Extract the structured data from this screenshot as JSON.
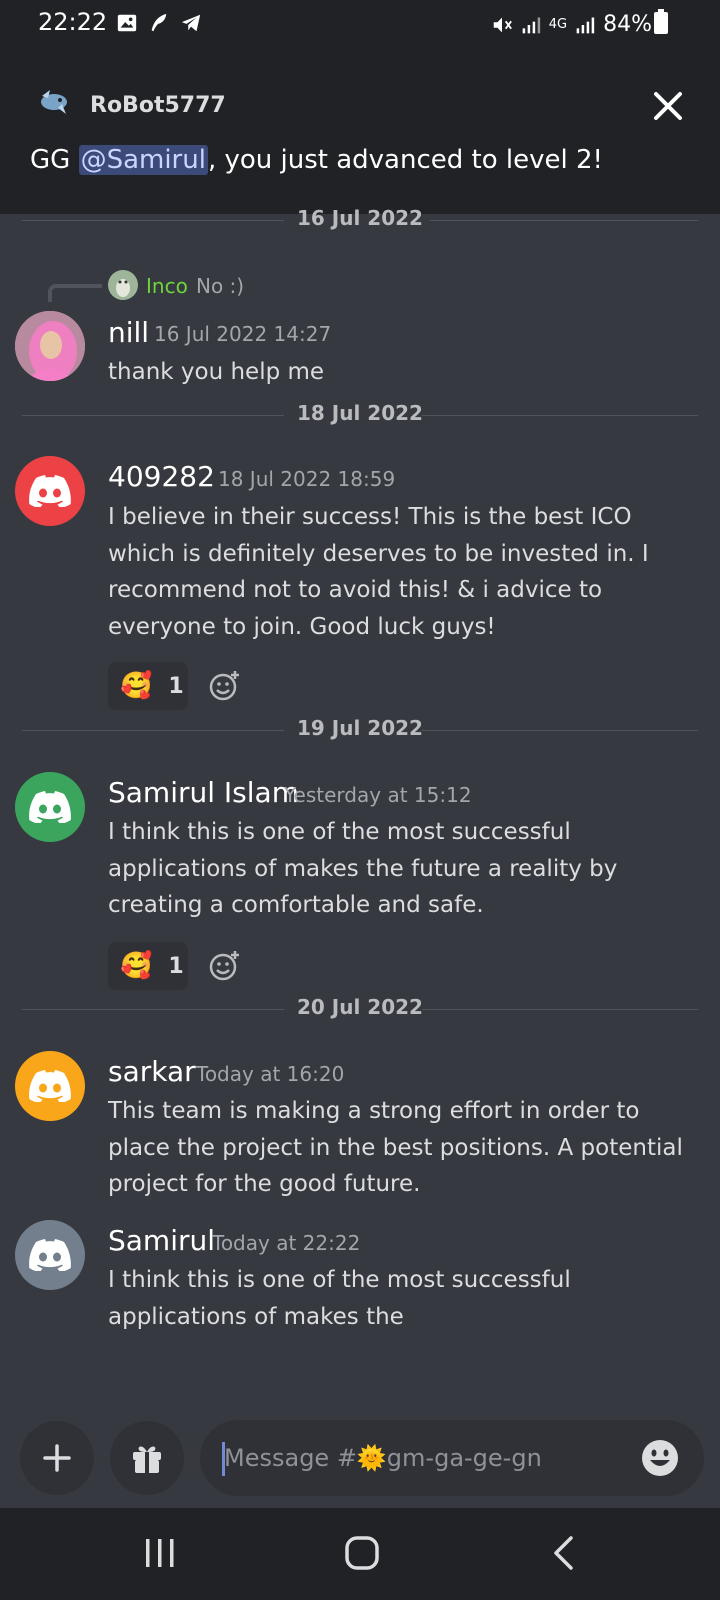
{
  "status_bar": {
    "time": "22:22",
    "battery": "84%",
    "network": "4G"
  },
  "banner": {
    "bot_name": "RoBot5777",
    "text_prefix": "GG ",
    "mention": "@Samirul",
    "text_suffix": ", you just advanced to level 2!"
  },
  "dates": [
    "16 Jul 2022",
    "18 Jul 2022",
    "19 Jul 2022",
    "20 Jul 2022"
  ],
  "messages": [
    {
      "author": "nill",
      "timestamp": "16 Jul 2022 14:27",
      "text": "thank you help me",
      "reply": {
        "author": "Inco",
        "text": "No :)"
      }
    },
    {
      "author": "409282",
      "timestamp": "18 Jul 2022 18:59",
      "text": "I believe in their success! This is the best ICO which is definitely deserves to be invested in. I recommend not to avoid this! & i advice to everyone to join. Good luck guys!",
      "avatar_color": "#ed4245",
      "reaction": {
        "emoji": "🥰",
        "count": "1"
      }
    },
    {
      "author": "Samirul Islam",
      "timestamp": "Yesterday at 15:12",
      "text": "I think this is one of the most successful applications of makes the future a reality by creating a comfortable and safe.",
      "avatar_color": "#3ba55d",
      "reaction": {
        "emoji": "🥰",
        "count": "1"
      }
    },
    {
      "author": "sarkar",
      "timestamp": "Today at 16:20",
      "text": "This team is making a strong effort in order to place the project in the best positions. A potential project for the good future.",
      "avatar_color": "#faa61a"
    },
    {
      "author": "Samirul",
      "timestamp": "Today at 22:22",
      "text": "I think this is one of the most successful applications of makes the",
      "avatar_color": "#747f8d"
    }
  ],
  "composer": {
    "placeholder": "Message #🌞gm-ga-ge-gn"
  },
  "icons": {
    "add": "plus-icon",
    "gift": "gift-icon",
    "emoji": "smiley-icon",
    "close": "close-icon"
  }
}
